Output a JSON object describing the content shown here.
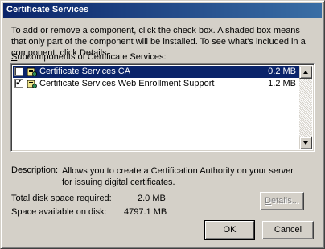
{
  "window": {
    "title": "Certificate Services"
  },
  "intro": "To add or remove a component, click the check box. A shaded box means that only part of the component will be installed. To see what's included in a component, click Details.",
  "subcomponents": {
    "label_prefix": "S",
    "label_rest": "ubcomponents of Certificate Services:",
    "items": [
      {
        "label": "Certificate Services CA",
        "size": "0.2 MB",
        "checked": false,
        "selected": true,
        "icon": "certificate-component-icon"
      },
      {
        "label": "Certificate Services Web Enrollment Support",
        "size": "1.2 MB",
        "checked": true,
        "selected": false,
        "icon": "certificate-component-icon"
      }
    ]
  },
  "description": {
    "label": "Description:",
    "text": "Allows you to create a Certification Authority on your server for issuing digital certificates."
  },
  "disk": {
    "total_label": "Total disk space required:",
    "total_value": "2.0 MB",
    "available_label": "Space available on disk:",
    "available_value": "4797.1 MB"
  },
  "buttons": {
    "details_prefix": "D",
    "details_rest": "etails...",
    "ok": "OK",
    "cancel": "Cancel"
  },
  "colors": {
    "title_bar": "#0a246a",
    "selection": "#0a246a",
    "face": "#d4d0c8"
  }
}
